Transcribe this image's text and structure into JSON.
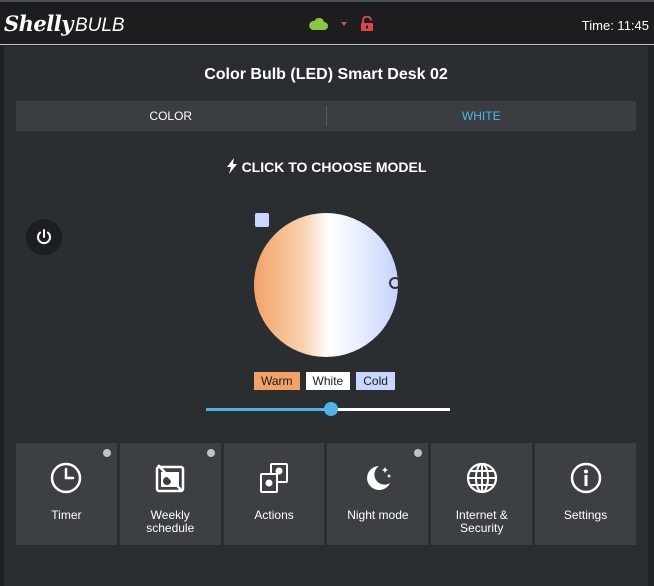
{
  "header": {
    "logo_primary": "Shelly",
    "logo_secondary": "BULB",
    "time_label": "Time: 11:45"
  },
  "device": {
    "title": "Color Bulb (LED) Smart Desk 02"
  },
  "tabs": [
    {
      "label": "COLOR",
      "active": false
    },
    {
      "label": "WHITE",
      "active": true
    }
  ],
  "model_link": "CLICK TO CHOOSE MODEL",
  "presets": [
    {
      "label": "Warm",
      "color": "#f2a266"
    },
    {
      "label": "White",
      "color": "#ffffff"
    },
    {
      "label": "Cold",
      "color": "#c9d6ff"
    }
  ],
  "slider": {
    "value_fraction": 0.52,
    "accent": "#4fb3e8"
  },
  "tiles": [
    {
      "label": "Timer",
      "icon": "clock-icon",
      "has_dot": true
    },
    {
      "label": "Weekly schedule",
      "icon": "calendar-icon",
      "has_dot": true
    },
    {
      "label": "Actions",
      "icon": "actions-icon",
      "has_dot": false
    },
    {
      "label": "Night mode",
      "icon": "moon-icon",
      "has_dot": true
    },
    {
      "label": "Internet & Security",
      "icon": "globe-icon",
      "has_dot": false
    },
    {
      "label": "Settings",
      "icon": "info-icon",
      "has_dot": false
    }
  ],
  "colors": {
    "accent": "#4fb3e8",
    "cloud": "#8dc63f",
    "alert": "#e0434b"
  }
}
